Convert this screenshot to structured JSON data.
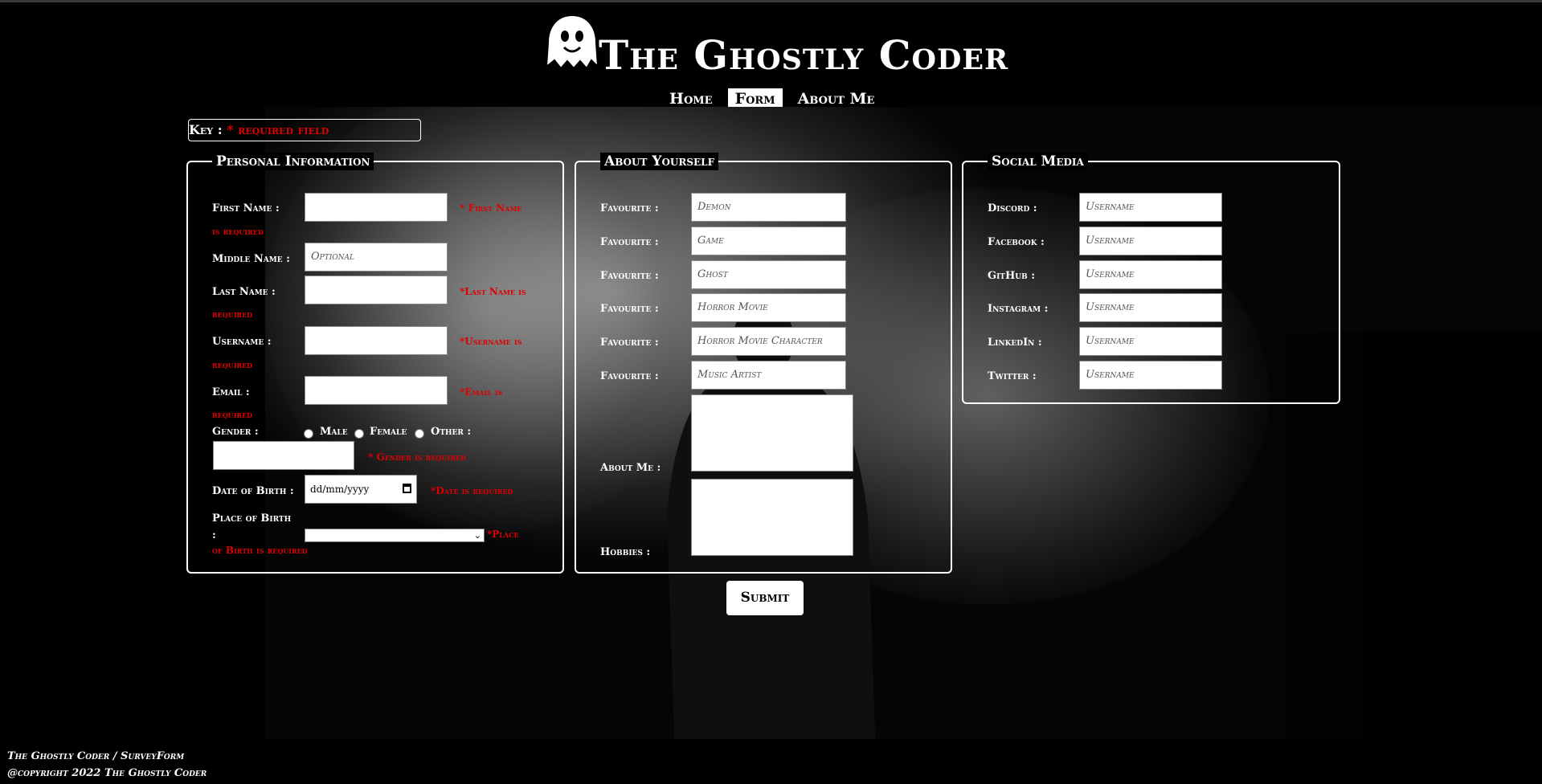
{
  "site": {
    "title": "The Ghostly Coder"
  },
  "nav": [
    {
      "label": "Home"
    },
    {
      "label": "Form"
    },
    {
      "label": "About Me"
    }
  ],
  "key": {
    "label": "Key :",
    "required": "* required field"
  },
  "personal": {
    "legend": "Personal Information",
    "first_name": {
      "label": "First Name :",
      "error_1": "* First Name",
      "error_2": "is required"
    },
    "middle_name": {
      "label": "Middle Name :",
      "placeholder": "Optional"
    },
    "last_name": {
      "label": "Last Name :",
      "error_1": "*Last Name is",
      "error_2": "required"
    },
    "username": {
      "label": "Username :",
      "error_1": "*Username is",
      "error_2": "required"
    },
    "email": {
      "label": "Email :",
      "error_1": "*Email is",
      "error_2": "required"
    },
    "gender": {
      "label": "Gender :",
      "options": [
        "Male",
        "Female",
        "Other :"
      ],
      "error": "* Gender is required"
    },
    "dob": {
      "label": "Date of Birth :",
      "value": "dd/mm/yyyy",
      "error": "*Date is required"
    },
    "pob": {
      "label_1": "Place of Birth",
      "label_2": ":",
      "error_1": "*Place",
      "error_2": "of Birth is required"
    }
  },
  "about": {
    "legend": "About Yourself",
    "favourites": [
      {
        "label": "Favourite :",
        "placeholder": "Demon"
      },
      {
        "label": "Favourite :",
        "placeholder": "Game"
      },
      {
        "label": "Favourite :",
        "placeholder": "Ghost"
      },
      {
        "label": "Favourite :",
        "placeholder": "Horror Movie"
      },
      {
        "label": "Favourite :",
        "placeholder": "Horror Movie Character"
      },
      {
        "label": "Favourite :",
        "placeholder": "Music Artist"
      }
    ],
    "about_me": "About Me :",
    "hobbies": "Hobbies :"
  },
  "social": {
    "legend": "Social Media",
    "items": [
      {
        "label": "Discord :",
        "placeholder": "Username"
      },
      {
        "label": "Facebook :",
        "placeholder": "Username"
      },
      {
        "label": "GitHub :",
        "placeholder": "Username"
      },
      {
        "label": "Instagram :",
        "placeholder": "Username"
      },
      {
        "label": "LinkedIn :",
        "placeholder": "Username"
      },
      {
        "label": "Twitter :",
        "placeholder": "Username"
      }
    ]
  },
  "submit": "Submit",
  "footer": {
    "line1": "The Ghostly Coder / SurveyForm",
    "line2": "@copyright 2022 The Ghostly Coder"
  },
  "colors": {
    "error": "#e00000",
    "background": "#000000",
    "text": "#ffffff"
  }
}
